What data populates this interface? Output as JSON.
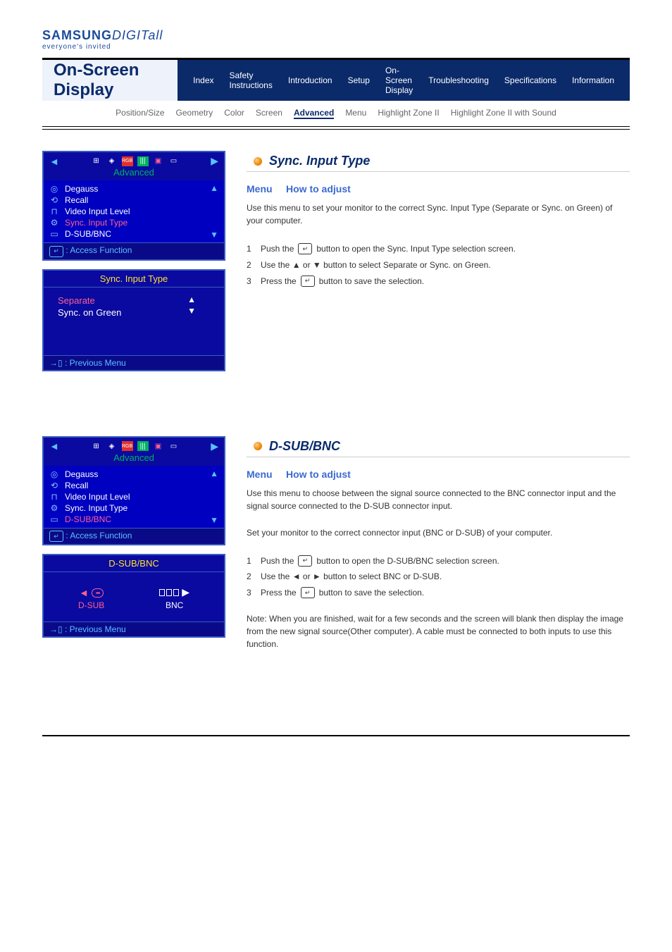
{
  "logo": {
    "brand": "SAMSUNG",
    "suffix": "DIGITall",
    "tagline": "everyone's invited"
  },
  "header": {
    "title": "On-Screen Display",
    "tabs": [
      "Index",
      "Safety Instructions",
      "Introduction",
      "Setup",
      "On-Screen Display",
      "Troubleshooting",
      "Specifications",
      "Information"
    ]
  },
  "subtabs": [
    "Position/Size",
    "Geometry",
    "Color",
    "Screen",
    "Advanced",
    "Menu",
    "Highlight Zone II",
    "Highlight Zone II with Sound"
  ],
  "osd_common": {
    "title": "Advanced",
    "list": [
      "Degauss",
      "Recall",
      "Video Input Level",
      "Sync. Input Type",
      "D-SUB/BNC"
    ],
    "access_hint": ": Access Function",
    "access_icon": "↵",
    "prev_hint": ": Previous Menu"
  },
  "section1": {
    "title": "Sync. Input Type",
    "selected_list_index": 3,
    "sub_title": "Sync. Input Type",
    "options": [
      "Separate",
      "Sync. on Green"
    ],
    "instr_menu": "Menu",
    "instr_menu_sub": "How to adjust",
    "desc": "Use this menu to set your monitor to the correct Sync. Input Type (Separate or Sync. on Green) of your computer.",
    "steps": [
      {
        "n": "1",
        "text": "Push the",
        "after": "button to open the Sync. Input Type selection screen."
      },
      {
        "n": "2",
        "text": "Use the ▲ or ▼ button to select Separate or Sync. on Green."
      },
      {
        "n": "3",
        "text": "Press the",
        "after": "button to save the selection."
      }
    ]
  },
  "section2": {
    "title": "D-SUB/BNC",
    "selected_list_index": 4,
    "sub_title": "D-SUB/BNC",
    "options": [
      "D-SUB",
      "BNC"
    ],
    "instr_menu": "Menu",
    "instr_menu_sub": "How to adjust",
    "desc1": "Use this menu to choose between the signal source connected to the BNC connector input and the signal source connected to the D-SUB connector input.",
    "desc2": "Set your monitor to the correct connector input (BNC or D-SUB) of your computer.",
    "steps": [
      {
        "n": "1",
        "text": "Push the",
        "after": "button to open the D-SUB/BNC selection screen."
      },
      {
        "n": "2",
        "text": "Use the ◄ or ► button to select BNC or D-SUB."
      },
      {
        "n": "3",
        "text": "Press the",
        "after": "button to save the selection."
      }
    ],
    "note": "Note: When you are finished, wait for a few seconds and the screen will blank then display the image from the new signal source(Other computer). A cable must be connected to both inputs to use this function."
  }
}
